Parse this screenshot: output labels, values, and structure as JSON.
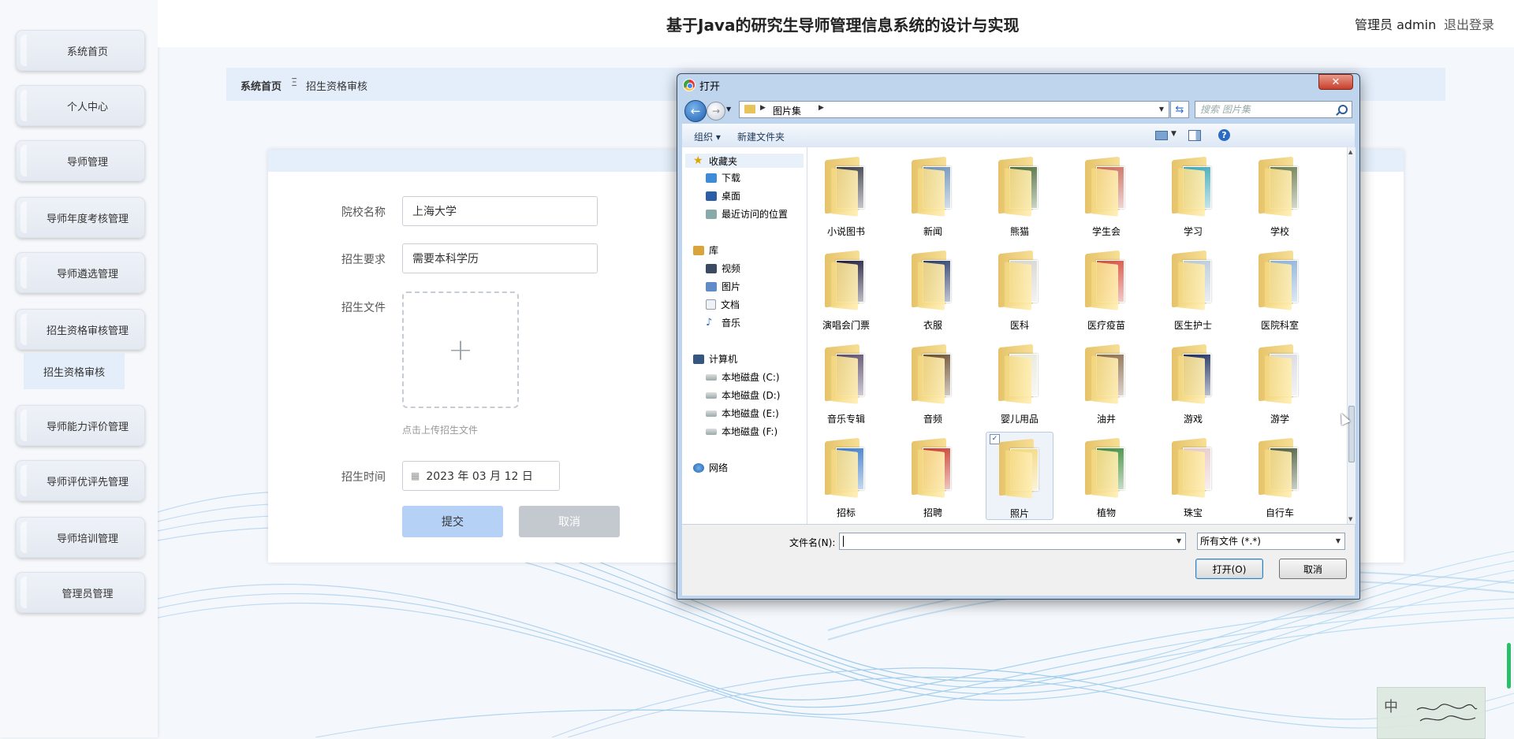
{
  "header": {
    "title": "基于Java的研究生导师管理信息系统的设计与实现",
    "admin_label": "管理员 admin",
    "logout": "退出登录"
  },
  "sidebar": {
    "items": [
      {
        "label": "系统首页"
      },
      {
        "label": "个人中心"
      },
      {
        "label": "导师管理"
      },
      {
        "label": "导师年度考核管理"
      },
      {
        "label": "导师遴选管理"
      },
      {
        "label": "招生资格审核管理"
      },
      {
        "label": "导师能力评价管理"
      },
      {
        "label": "导师评优评先管理"
      },
      {
        "label": "导师培训管理"
      },
      {
        "label": "管理员管理"
      }
    ],
    "active_sub": "招生资格审核"
  },
  "breadcrumb": {
    "home": "系统首页",
    "separator": "Ξ",
    "current": "招生资格审核"
  },
  "form": {
    "school": {
      "label": "院校名称",
      "value": "上海大学"
    },
    "requirement": {
      "label": "招生要求",
      "value": "需要本科学历"
    },
    "file": {
      "label": "招生文件",
      "plus": "+",
      "hint": "点击上传招生文件"
    },
    "time": {
      "label": "招生时间",
      "value": "2023 年 03 月 12 日"
    },
    "submit": "提交",
    "cancel": "取消"
  },
  "dialog": {
    "title": "打开",
    "close": "✕",
    "address": "图片集",
    "search_placeholder": "搜索 图片集",
    "toolbar": {
      "organize": "组织 ▾",
      "new_folder": "新建文件夹",
      "help": "?"
    },
    "nav": {
      "favorites": "收藏夹",
      "downloads": "下载",
      "desktop": "桌面",
      "recent": "最近访问的位置",
      "libraries": "库",
      "videos": "视频",
      "pictures": "图片",
      "documents": "文档",
      "music": "音乐",
      "computer": "计算机",
      "drive_c": "本地磁盘 (C:)",
      "drive_d": "本地磁盘 (D:)",
      "drive_e": "本地磁盘 (E:)",
      "drive_f": "本地磁盘 (F:)",
      "network": "网络"
    },
    "folders": [
      {
        "name": "小说图书",
        "color": "#3a3a46"
      },
      {
        "name": "新闻",
        "color": "#6a8fb8"
      },
      {
        "name": "熊猫",
        "color": "#4c6b3a"
      },
      {
        "name": "学生会",
        "color": "#c96a5a"
      },
      {
        "name": "学习",
        "color": "#3aa7b8"
      },
      {
        "name": "学校",
        "color": "#6a7a4a"
      },
      {
        "name": "演唱会门票",
        "color": "#1e1a3a"
      },
      {
        "name": "衣服",
        "color": "#2a3a6a"
      },
      {
        "name": "医科",
        "color": "#d8d4cf"
      },
      {
        "name": "医疗疫苗",
        "color": "#d64a3a"
      },
      {
        "name": "医生护士",
        "color": "#b8c8d8"
      },
      {
        "name": "医院科室",
        "color": "#8ab0d8"
      },
      {
        "name": "音乐专辑",
        "color": "#5a4a6a"
      },
      {
        "name": "音频",
        "color": "#6a4a2a"
      },
      {
        "name": "婴儿用品",
        "color": "#e8e8d8"
      },
      {
        "name": "油井",
        "color": "#8a6a4a"
      },
      {
        "name": "游戏",
        "color": "#1a2a5a"
      },
      {
        "name": "游学",
        "color": "#d8d8e0"
      },
      {
        "name": "招标",
        "color": "#3a7ac8"
      },
      {
        "name": "招聘",
        "color": "#c83a2a"
      },
      {
        "name": "照片",
        "color": "#f3d77f"
      },
      {
        "name": "植物",
        "color": "#3a8a3a"
      },
      {
        "name": "珠宝",
        "color": "#e8c8c8"
      },
      {
        "name": "自行车",
        "color": "#4a5a3a"
      }
    ],
    "selected_folder": "照片",
    "filename_label": "文件名(N):",
    "filename_value": "",
    "filetype": "所有文件 (*.*)",
    "open": "打开(O)",
    "cancel": "取消"
  },
  "widget": {
    "zh": "中"
  }
}
